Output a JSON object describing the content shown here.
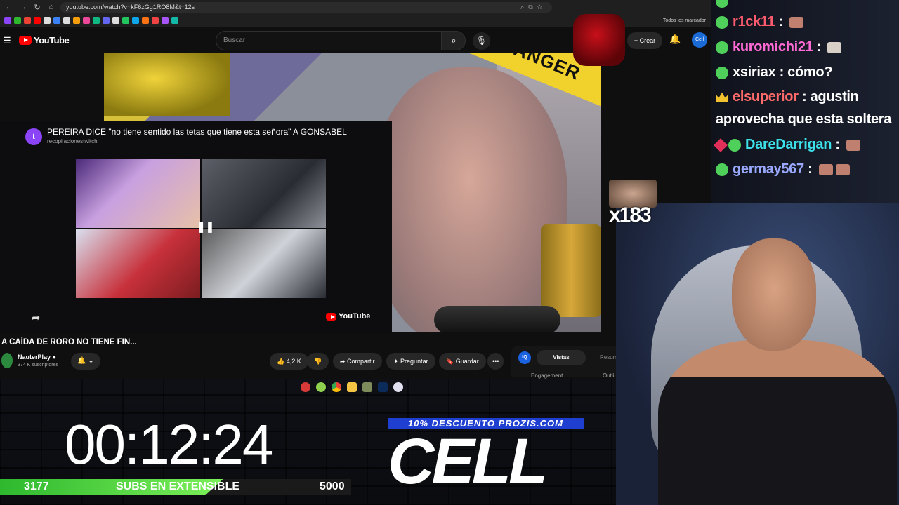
{
  "browser": {
    "url": "youtube.com/watch?v=kF6zGg1RO8M&t=12s",
    "bookmarks_label": "Todos los marcador"
  },
  "youtube": {
    "logo_text": "YouTube",
    "search_placeholder": "Buscar",
    "create_label": "Crear",
    "avatar_text": "Cell"
  },
  "embed": {
    "title": "PEREIRA DICE \"no tiene sentido las tetas que tiene esta señora\" A GONSABEL",
    "channel": "recopilacionestwitch",
    "watermark": "YouTube"
  },
  "video": {
    "title": "A CAÍDA DE RORO NO TIENE FIN...",
    "channel_name": "NauterPlay",
    "subscribers": "374 K suscriptores",
    "likes": "4,2 K",
    "share_label": "Compartir",
    "ask_label": "Preguntar",
    "save_label": "Guardar",
    "danger_text": "DANGER"
  },
  "side_panel": {
    "badge": "IQ",
    "tab_active": "Vistas",
    "tab_other": "Resum",
    "engagement": "Engagement",
    "outlier": "Outli"
  },
  "chat": [
    {
      "user": "r1ck11",
      "color": "#ff5b6e",
      "message": "",
      "badge": "green"
    },
    {
      "user": "kuromichi21",
      "color": "#ff6ad5",
      "message": "",
      "badge": "green"
    },
    {
      "user": "xsiriax",
      "color": "#ffffff",
      "message": ": cómo?",
      "badge": "green"
    },
    {
      "user": "elsuperior",
      "color": "#ff6b6b",
      "message": ": agustin",
      "badge": "crown"
    },
    {
      "user": "",
      "color": "#ffffff",
      "message": "aprovecha que esta soltera",
      "badge": "none"
    },
    {
      "user": "DareDarrigan",
      "color": "#3de0e8",
      "message": ":",
      "badge": "cube"
    },
    {
      "user": "germay567",
      "color": "#9aa9ff",
      "message": ":",
      "badge": "green"
    }
  ],
  "overlay": {
    "emote_count": "x183",
    "timer": "00:12:24",
    "subs_current": "3177",
    "subs_label": "SUBS EN EXTENSIBLE",
    "subs_goal": "5000",
    "subs_progress": 0.6354,
    "promo": "10% DESCUENTO PROZIS.COM",
    "brand": "CELL"
  },
  "colors": {
    "youtube_red": "#ff0000",
    "twitch_purple": "#8b44f7",
    "subs_green": "#2eb82e",
    "promo_blue": "#1e3fd0"
  }
}
